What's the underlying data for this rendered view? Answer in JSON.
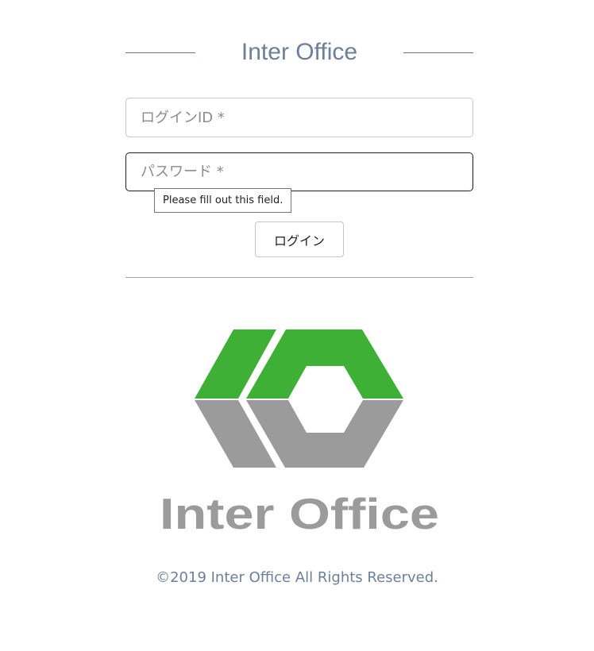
{
  "header": {
    "title": "Inter Office"
  },
  "form": {
    "login_id_placeholder": "ログインID *",
    "password_placeholder": "パスワード *",
    "validation_tooltip": "Please fill out this field.",
    "login_button_label": "ログイン"
  },
  "logo": {
    "wordmark": "Inter Office",
    "green_color": "#3db035",
    "gray_color": "#9b9b9b"
  },
  "footer": {
    "copyright": "©2019 Inter Office All Rights Reserved."
  }
}
